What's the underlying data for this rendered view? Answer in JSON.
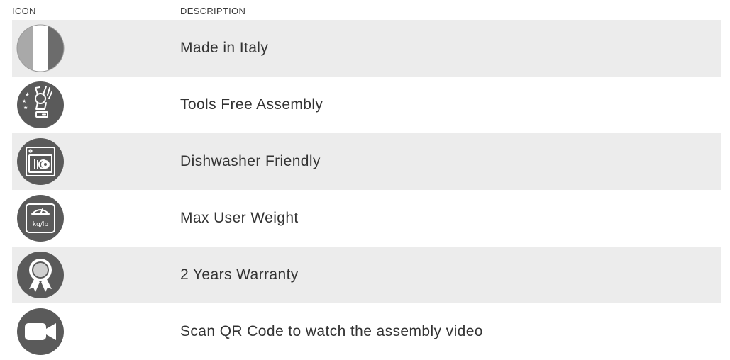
{
  "header": {
    "icon_label": "ICON",
    "description_label": "DESCRIPTION"
  },
  "rows": [
    {
      "icon": "italy-flag-icon",
      "description": "Made in Italy"
    },
    {
      "icon": "tools-free-assembly-icon",
      "description": "Tools Free Assembly"
    },
    {
      "icon": "dishwasher-icon",
      "description": "Dishwasher Friendly"
    },
    {
      "icon": "scale-icon",
      "description": "Max User Weight",
      "icon_text": "kg/lb"
    },
    {
      "icon": "warranty-ribbon-icon",
      "description": "2 Years Warranty"
    },
    {
      "icon": "video-camera-icon",
      "description": "Scan QR Code to watch the assembly video"
    }
  ],
  "colors": {
    "icon_fill": "#5a5a5a",
    "row_shade": "#ececec",
    "text": "#333333"
  }
}
